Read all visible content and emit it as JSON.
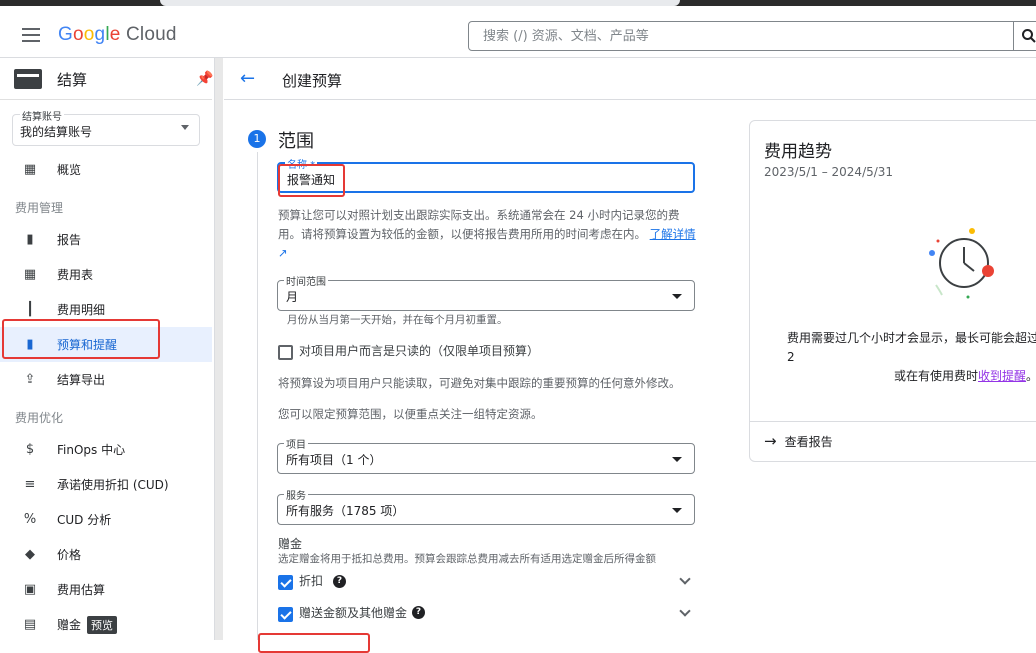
{
  "header": {
    "logo_parts": [
      "G",
      "o",
      "o",
      "g",
      "l",
      "e"
    ],
    "logo_cloud": "Cloud",
    "search_placeholder": "搜索 (/) 资源、文档、产品等"
  },
  "sidebar": {
    "title": "结算",
    "account_label": "结算账号",
    "account_value": "我的结算账号",
    "items": [
      {
        "label": "概览",
        "icon": "overview-icon",
        "glyph": "▦"
      },
      {
        "label": "报告",
        "icon": "bar-chart-icon",
        "glyph": "▮"
      },
      {
        "label": "费用表",
        "icon": "table-icon",
        "glyph": "▦"
      },
      {
        "label": "费用明细",
        "icon": "breakdown-icon",
        "glyph": "┃"
      },
      {
        "label": "预算和提醒",
        "icon": "budget-icon",
        "glyph": "▮"
      },
      {
        "label": "结算导出",
        "icon": "export-icon",
        "glyph": "⇪"
      },
      {
        "label": "FinOps 中心",
        "icon": "dollar-icon",
        "glyph": "$"
      },
      {
        "label": "承诺使用折扣 (CUD)",
        "icon": "list-icon",
        "glyph": "≡"
      },
      {
        "label": "CUD 分析",
        "icon": "percent-icon",
        "glyph": "%"
      },
      {
        "label": "价格",
        "icon": "tag-icon",
        "glyph": "◆"
      },
      {
        "label": "费用估算",
        "icon": "calculator-icon",
        "glyph": "▣"
      },
      {
        "label": "赠金",
        "icon": "gift-icon",
        "glyph": "▤",
        "badge": "预览"
      }
    ],
    "section_cost_mgmt": "费用管理",
    "section_cost_opt": "费用优化"
  },
  "page": {
    "back_glyph": "←",
    "title": "创建预算"
  },
  "form": {
    "step_number": "1",
    "step_title": "范围",
    "name_label": "名称 *",
    "name_value": "报警通知",
    "desc": "预算让您可以对照计划支出跟踪实际支出。系统通常会在 24 小时内记录您的费用。请将预算设置为较低的金额，以便将报告费用所用的时间考虑在内。",
    "desc_link": "了解详情",
    "time_label": "时间范围",
    "time_value": "月",
    "time_hint": "月份从当月第一天开始，并在每个月月初重置。",
    "readonly_label": "对项目用户而言是只读的（仅限单项目预算）",
    "readonly_desc": "将预算设为项目用户只能读取，可避免对集中跟踪的重要预算的任何意外修改。",
    "scope_desc": "您可以限定预算范围，以便重点关注一组特定资源。",
    "project_label": "项目",
    "project_value": "所有项目（1 个）",
    "service_label": "服务",
    "service_value": "所有服务（1785 项）",
    "credits_title": "赠金",
    "credits_desc": "选定赠金将用于抵扣总费用。预算会跟踪总费用减去所有适用选定赠金后所得金额",
    "discount_label": "折扣",
    "promo_label": "赠送金额及其他赠金"
  },
  "trend": {
    "title": "费用趋势",
    "date_range": "2023/5/1 – 2024/5/31",
    "msg_line1": "费用需要过几个小时才会显示，最长可能会超过 2",
    "msg_line2_pre": "或在有使用费时",
    "msg_link": "收到提醒",
    "msg_line2_post": "。",
    "view_report": "查看报告"
  },
  "colors": {
    "accent": "#1a73e8",
    "highlight_red": "#e53935"
  }
}
